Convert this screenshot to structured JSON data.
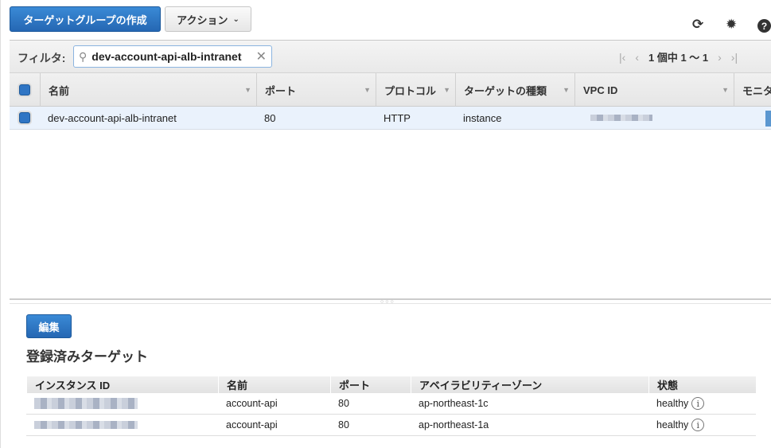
{
  "toolbar": {
    "create_label": "ターゲットグループの作成",
    "actions_label": "アクション",
    "icons": [
      "refresh-icon",
      "gear-icon",
      "help-icon"
    ]
  },
  "filter": {
    "label": "フィルタ:",
    "value": "dev-account-api-alb-intranet",
    "pagination": "1 個中 1 〜 1"
  },
  "table": {
    "columns": [
      "名前",
      "ポート",
      "プロトコル",
      "ターゲットの種類",
      "VPC ID",
      "モニタ"
    ],
    "rows": [
      {
        "name": "dev-account-api-alb-intranet",
        "port": "80",
        "protocol": "HTTP",
        "target_type": "instance",
        "vpc_id": "(blurred)"
      }
    ]
  },
  "detail": {
    "edit_label": "編集",
    "heading": "登録済みターゲット",
    "columns": [
      "インスタンス ID",
      "名前",
      "ポート",
      "アベイラビリティーゾーン",
      "状態"
    ],
    "rows": [
      {
        "name": "account-api",
        "port": "80",
        "zone": "ap-northeast-1c",
        "status": "healthy"
      },
      {
        "name": "account-api",
        "port": "80",
        "zone": "ap-northeast-1a",
        "status": "healthy"
      }
    ]
  },
  "colors": {
    "primary": "#2f75c4",
    "selected_row": "#eaf2fc"
  }
}
